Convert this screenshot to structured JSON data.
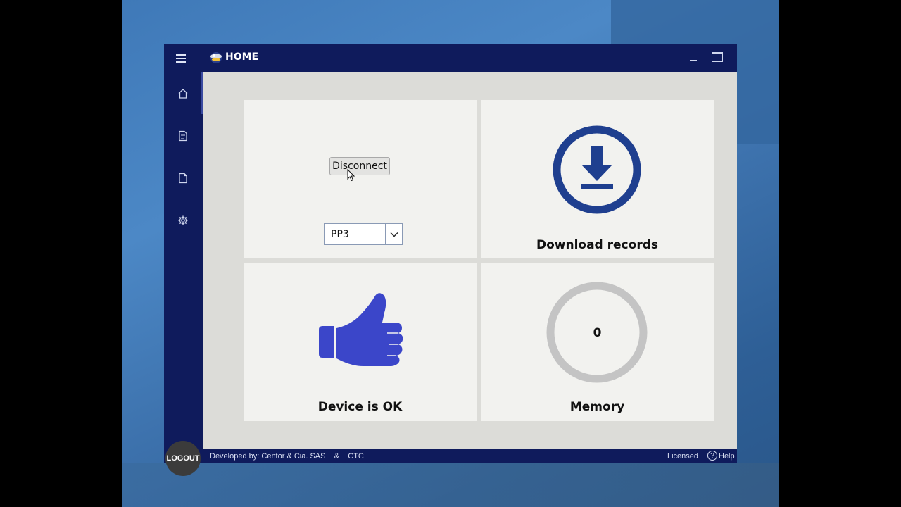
{
  "window": {
    "title": "HOME"
  },
  "sidebar": {
    "items": [
      {
        "name": "home",
        "icon": "home-icon"
      },
      {
        "name": "records",
        "icon": "document-list-icon"
      },
      {
        "name": "file",
        "icon": "file-icon"
      },
      {
        "name": "settings",
        "icon": "gear-icon"
      }
    ],
    "logout_label": "LOGOUT"
  },
  "connection": {
    "button_label": "Disconnect",
    "device_selected": "PP3"
  },
  "tiles": {
    "download_label": "Download records",
    "status_label": "Device is OK",
    "memory_label": "Memory",
    "memory_value": "0"
  },
  "statusbar": {
    "developer_text": "Developed by: Centor & Cia. SAS    &    CTC",
    "license_text": "Licensed",
    "help_label": "Help"
  },
  "colors": {
    "chrome": "#0f1b5c",
    "download_icon": "#1f3f8f",
    "thumb_icon": "#3b46c9",
    "memory_ring": "#c4c4c4"
  }
}
